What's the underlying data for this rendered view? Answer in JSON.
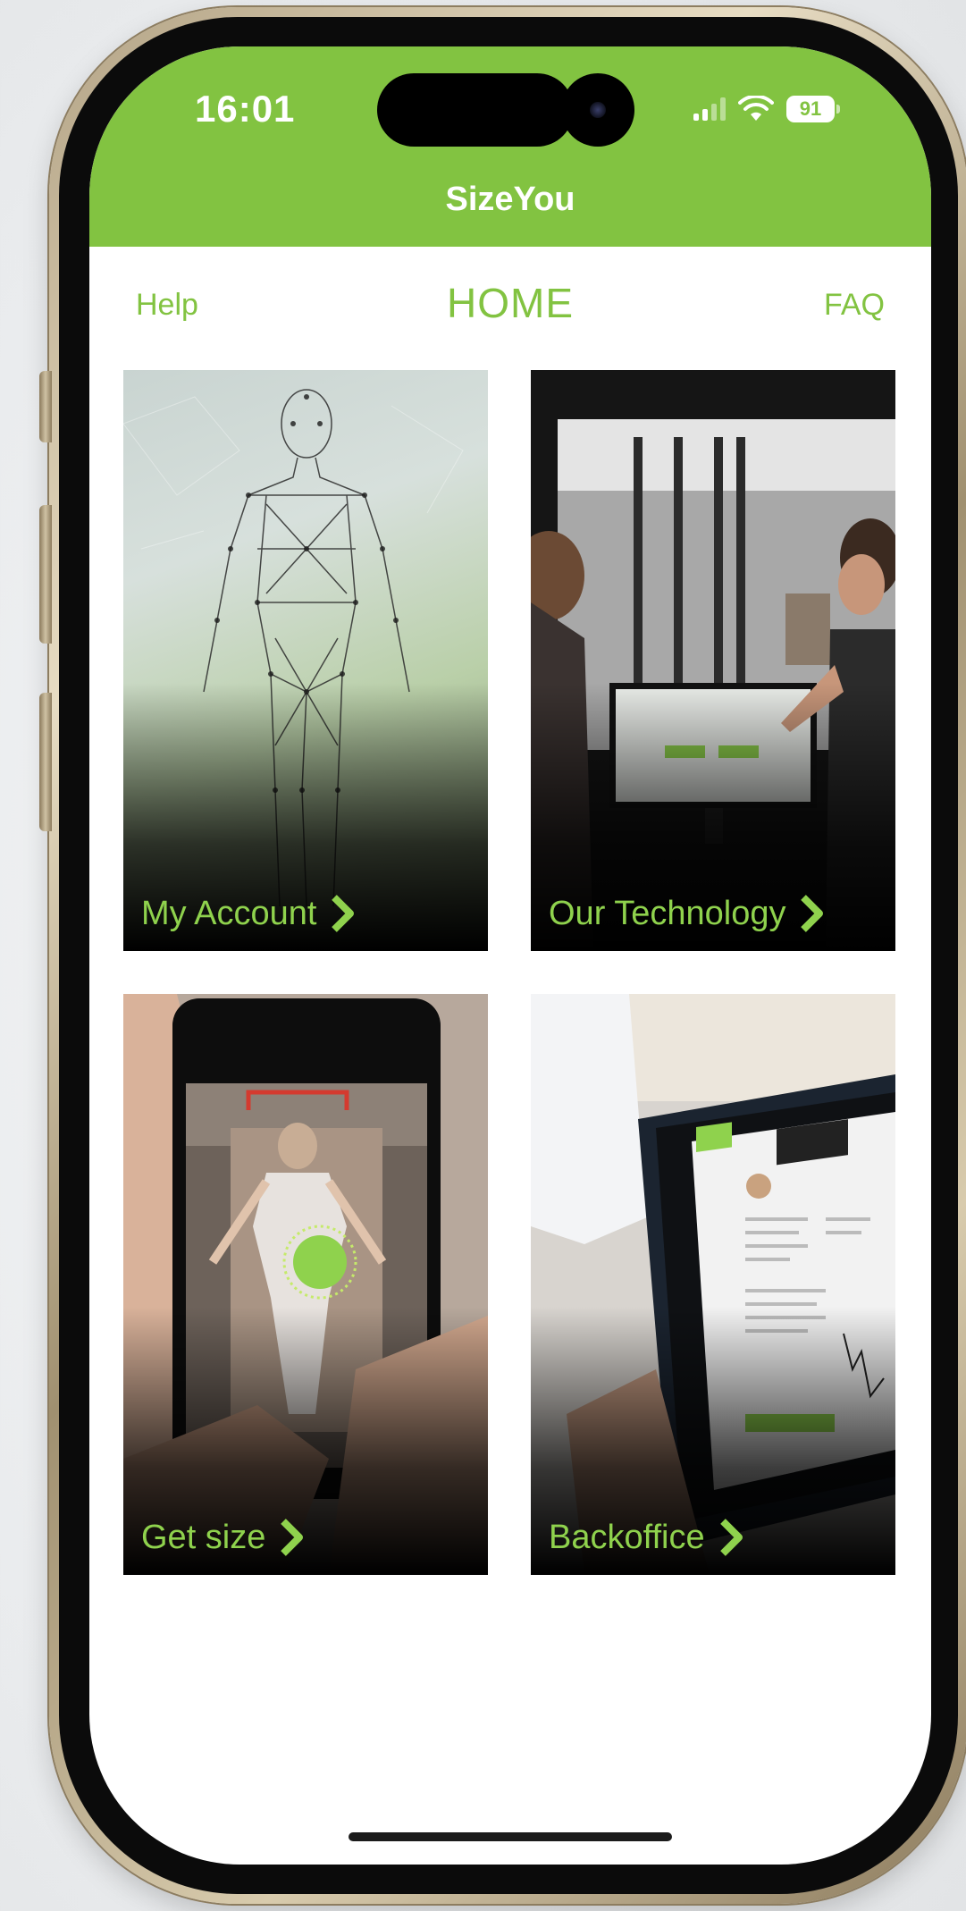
{
  "status_bar": {
    "time": "16:01",
    "battery": "91"
  },
  "header": {
    "title": "SizeYou",
    "background_color": "#82c341"
  },
  "nav": {
    "left": "Help",
    "center": "HOME",
    "right": "FAQ"
  },
  "tiles": [
    {
      "label": "My Account",
      "icon": "chevron-right-icon",
      "image": "human-wireframe-figure"
    },
    {
      "label": "Our Technology",
      "icon": "chevron-right-icon",
      "image": "people-at-scanner-monitor"
    },
    {
      "label": "Get size",
      "icon": "chevron-right-icon",
      "image": "hand-holding-phone-scan"
    },
    {
      "label": "Backoffice",
      "icon": "chevron-right-icon",
      "image": "tablet-dashboard"
    }
  ],
  "accent_color": "#8fd24d"
}
